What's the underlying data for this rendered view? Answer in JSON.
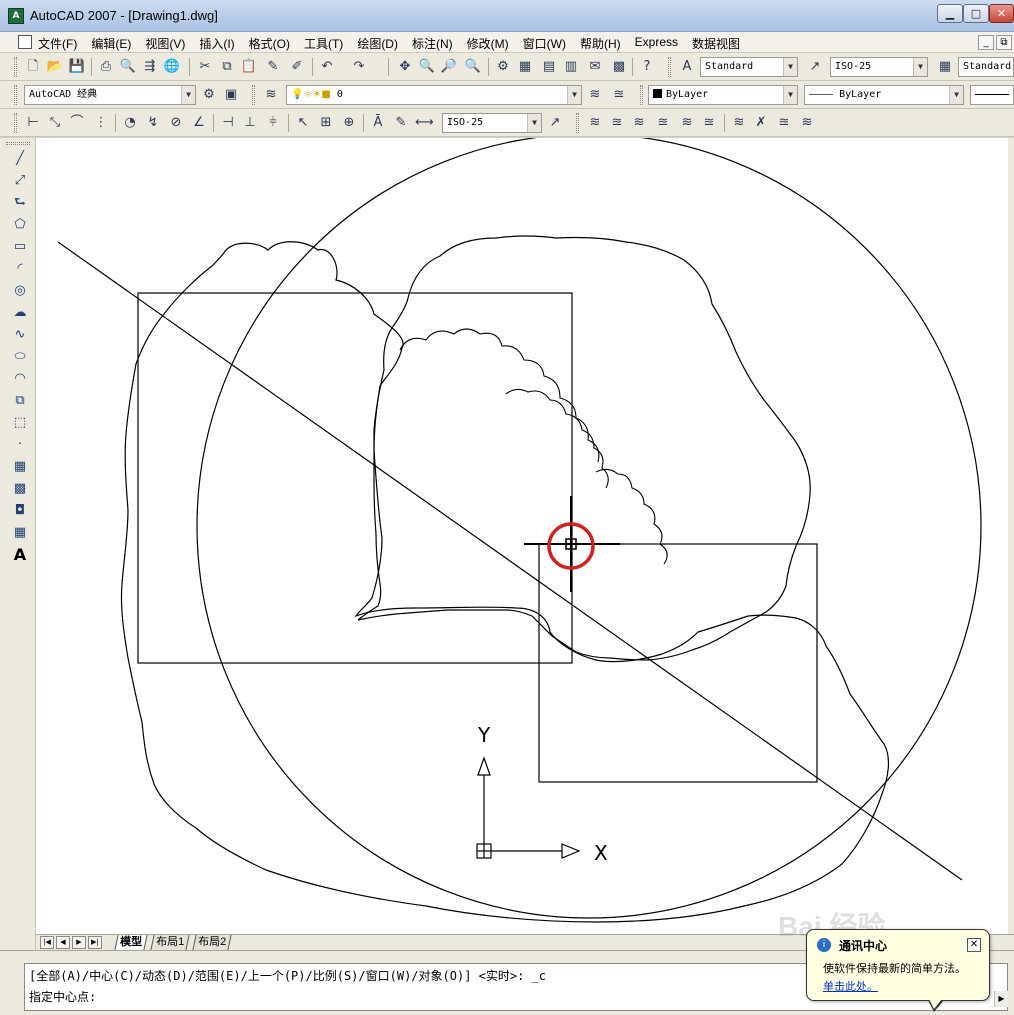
{
  "window": {
    "title": "AutoCAD 2007 - [Drawing1.dwg]",
    "logo_text": "A",
    "minimize_label": "▁",
    "maximize_label": "□",
    "close_label": "✕"
  },
  "menu": {
    "items": [
      {
        "label": "文件(F)"
      },
      {
        "label": "编辑(E)"
      },
      {
        "label": "视图(V)"
      },
      {
        "label": "插入(I)"
      },
      {
        "label": "格式(O)"
      },
      {
        "label": "工具(T)"
      },
      {
        "label": "绘图(D)"
      },
      {
        "label": "标注(N)"
      },
      {
        "label": "修改(M)"
      },
      {
        "label": "窗口(W)"
      },
      {
        "label": "帮助(H)"
      },
      {
        "label": "Express"
      },
      {
        "label": "数据视图"
      }
    ],
    "mdi_minimize": "_",
    "mdi_restore": "⧉"
  },
  "toolbars": {
    "text_style": "Standard",
    "dim_style": "ISO-25",
    "table_style": "Standard",
    "workspace": "AutoCAD 经典",
    "layer": "0",
    "color": "ByLayer",
    "linetype": "———— ByLayer",
    "dim_style_2": "ISO-25",
    "dropdown_arrow": "▼",
    "layer_bulbs": "💡☼☀■"
  },
  "draw_tools": {
    "line": "╱",
    "xline": "⤢",
    "polyline": "⮑",
    "polygon": "⬠",
    "rectangle": "▭",
    "arc": "◜",
    "circle": "◎",
    "revcloud": "☁",
    "spline": "∿",
    "ellipse": "⬭",
    "ellipse_arc": "◠",
    "insert_block": "⧉",
    "make_block": "⬚",
    "point": "·",
    "hatch": "▦",
    "gradient": "▩",
    "region": "◘",
    "table": "▦",
    "mtext": "A"
  },
  "canvas": {
    "ucs_y_label": "Y",
    "ucs_x_label": "X",
    "highlight_color": "#d42020"
  },
  "tabs": {
    "nav_first": "|◀",
    "nav_prev": "◀",
    "nav_next": "▶",
    "nav_last": "▶|",
    "model": "模型",
    "layout1": "布局1",
    "layout2": "布局2"
  },
  "command": {
    "history": "[全部(A)/中心(C)/动态(D)/范围(E)/上一个(P)/比例(S)/窗口(W)/对象(O)] <实时>: _c",
    "prompt": "指定中心点:",
    "scroll_arrow": "▶"
  },
  "notification": {
    "icon": "i",
    "title": "通讯中心",
    "message": "使软件保持最新的简单方法。",
    "link": "单击此处。",
    "close": "✕"
  },
  "watermark": "Bai 经验"
}
